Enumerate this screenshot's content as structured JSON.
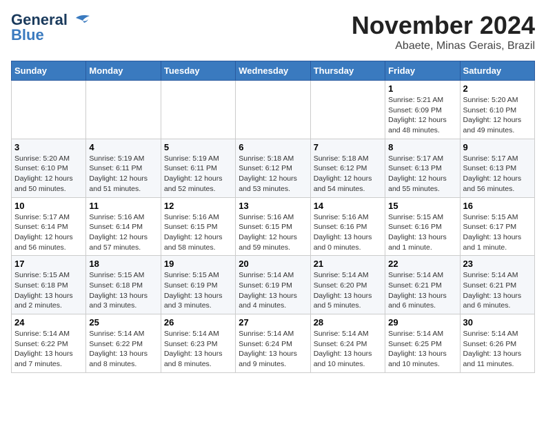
{
  "logo": {
    "line1": "General",
    "line2": "Blue"
  },
  "title": "November 2024",
  "location": "Abaete, Minas Gerais, Brazil",
  "days_of_week": [
    "Sunday",
    "Monday",
    "Tuesday",
    "Wednesday",
    "Thursday",
    "Friday",
    "Saturday"
  ],
  "weeks": [
    [
      {
        "day": "",
        "info": ""
      },
      {
        "day": "",
        "info": ""
      },
      {
        "day": "",
        "info": ""
      },
      {
        "day": "",
        "info": ""
      },
      {
        "day": "",
        "info": ""
      },
      {
        "day": "1",
        "info": "Sunrise: 5:21 AM\nSunset: 6:09 PM\nDaylight: 12 hours\nand 48 minutes."
      },
      {
        "day": "2",
        "info": "Sunrise: 5:20 AM\nSunset: 6:10 PM\nDaylight: 12 hours\nand 49 minutes."
      }
    ],
    [
      {
        "day": "3",
        "info": "Sunrise: 5:20 AM\nSunset: 6:10 PM\nDaylight: 12 hours\nand 50 minutes."
      },
      {
        "day": "4",
        "info": "Sunrise: 5:19 AM\nSunset: 6:11 PM\nDaylight: 12 hours\nand 51 minutes."
      },
      {
        "day": "5",
        "info": "Sunrise: 5:19 AM\nSunset: 6:11 PM\nDaylight: 12 hours\nand 52 minutes."
      },
      {
        "day": "6",
        "info": "Sunrise: 5:18 AM\nSunset: 6:12 PM\nDaylight: 12 hours\nand 53 minutes."
      },
      {
        "day": "7",
        "info": "Sunrise: 5:18 AM\nSunset: 6:12 PM\nDaylight: 12 hours\nand 54 minutes."
      },
      {
        "day": "8",
        "info": "Sunrise: 5:17 AM\nSunset: 6:13 PM\nDaylight: 12 hours\nand 55 minutes."
      },
      {
        "day": "9",
        "info": "Sunrise: 5:17 AM\nSunset: 6:13 PM\nDaylight: 12 hours\nand 56 minutes."
      }
    ],
    [
      {
        "day": "10",
        "info": "Sunrise: 5:17 AM\nSunset: 6:14 PM\nDaylight: 12 hours\nand 56 minutes."
      },
      {
        "day": "11",
        "info": "Sunrise: 5:16 AM\nSunset: 6:14 PM\nDaylight: 12 hours\nand 57 minutes."
      },
      {
        "day": "12",
        "info": "Sunrise: 5:16 AM\nSunset: 6:15 PM\nDaylight: 12 hours\nand 58 minutes."
      },
      {
        "day": "13",
        "info": "Sunrise: 5:16 AM\nSunset: 6:15 PM\nDaylight: 12 hours\nand 59 minutes."
      },
      {
        "day": "14",
        "info": "Sunrise: 5:16 AM\nSunset: 6:16 PM\nDaylight: 13 hours\nand 0 minutes."
      },
      {
        "day": "15",
        "info": "Sunrise: 5:15 AM\nSunset: 6:16 PM\nDaylight: 13 hours\nand 1 minute."
      },
      {
        "day": "16",
        "info": "Sunrise: 5:15 AM\nSunset: 6:17 PM\nDaylight: 13 hours\nand 1 minute."
      }
    ],
    [
      {
        "day": "17",
        "info": "Sunrise: 5:15 AM\nSunset: 6:18 PM\nDaylight: 13 hours\nand 2 minutes."
      },
      {
        "day": "18",
        "info": "Sunrise: 5:15 AM\nSunset: 6:18 PM\nDaylight: 13 hours\nand 3 minutes."
      },
      {
        "day": "19",
        "info": "Sunrise: 5:15 AM\nSunset: 6:19 PM\nDaylight: 13 hours\nand 3 minutes."
      },
      {
        "day": "20",
        "info": "Sunrise: 5:14 AM\nSunset: 6:19 PM\nDaylight: 13 hours\nand 4 minutes."
      },
      {
        "day": "21",
        "info": "Sunrise: 5:14 AM\nSunset: 6:20 PM\nDaylight: 13 hours\nand 5 minutes."
      },
      {
        "day": "22",
        "info": "Sunrise: 5:14 AM\nSunset: 6:21 PM\nDaylight: 13 hours\nand 6 minutes."
      },
      {
        "day": "23",
        "info": "Sunrise: 5:14 AM\nSunset: 6:21 PM\nDaylight: 13 hours\nand 6 minutes."
      }
    ],
    [
      {
        "day": "24",
        "info": "Sunrise: 5:14 AM\nSunset: 6:22 PM\nDaylight: 13 hours\nand 7 minutes."
      },
      {
        "day": "25",
        "info": "Sunrise: 5:14 AM\nSunset: 6:22 PM\nDaylight: 13 hours\nand 8 minutes."
      },
      {
        "day": "26",
        "info": "Sunrise: 5:14 AM\nSunset: 6:23 PM\nDaylight: 13 hours\nand 8 minutes."
      },
      {
        "day": "27",
        "info": "Sunrise: 5:14 AM\nSunset: 6:24 PM\nDaylight: 13 hours\nand 9 minutes."
      },
      {
        "day": "28",
        "info": "Sunrise: 5:14 AM\nSunset: 6:24 PM\nDaylight: 13 hours\nand 10 minutes."
      },
      {
        "day": "29",
        "info": "Sunrise: 5:14 AM\nSunset: 6:25 PM\nDaylight: 13 hours\nand 10 minutes."
      },
      {
        "day": "30",
        "info": "Sunrise: 5:14 AM\nSunset: 6:26 PM\nDaylight: 13 hours\nand 11 minutes."
      }
    ]
  ]
}
